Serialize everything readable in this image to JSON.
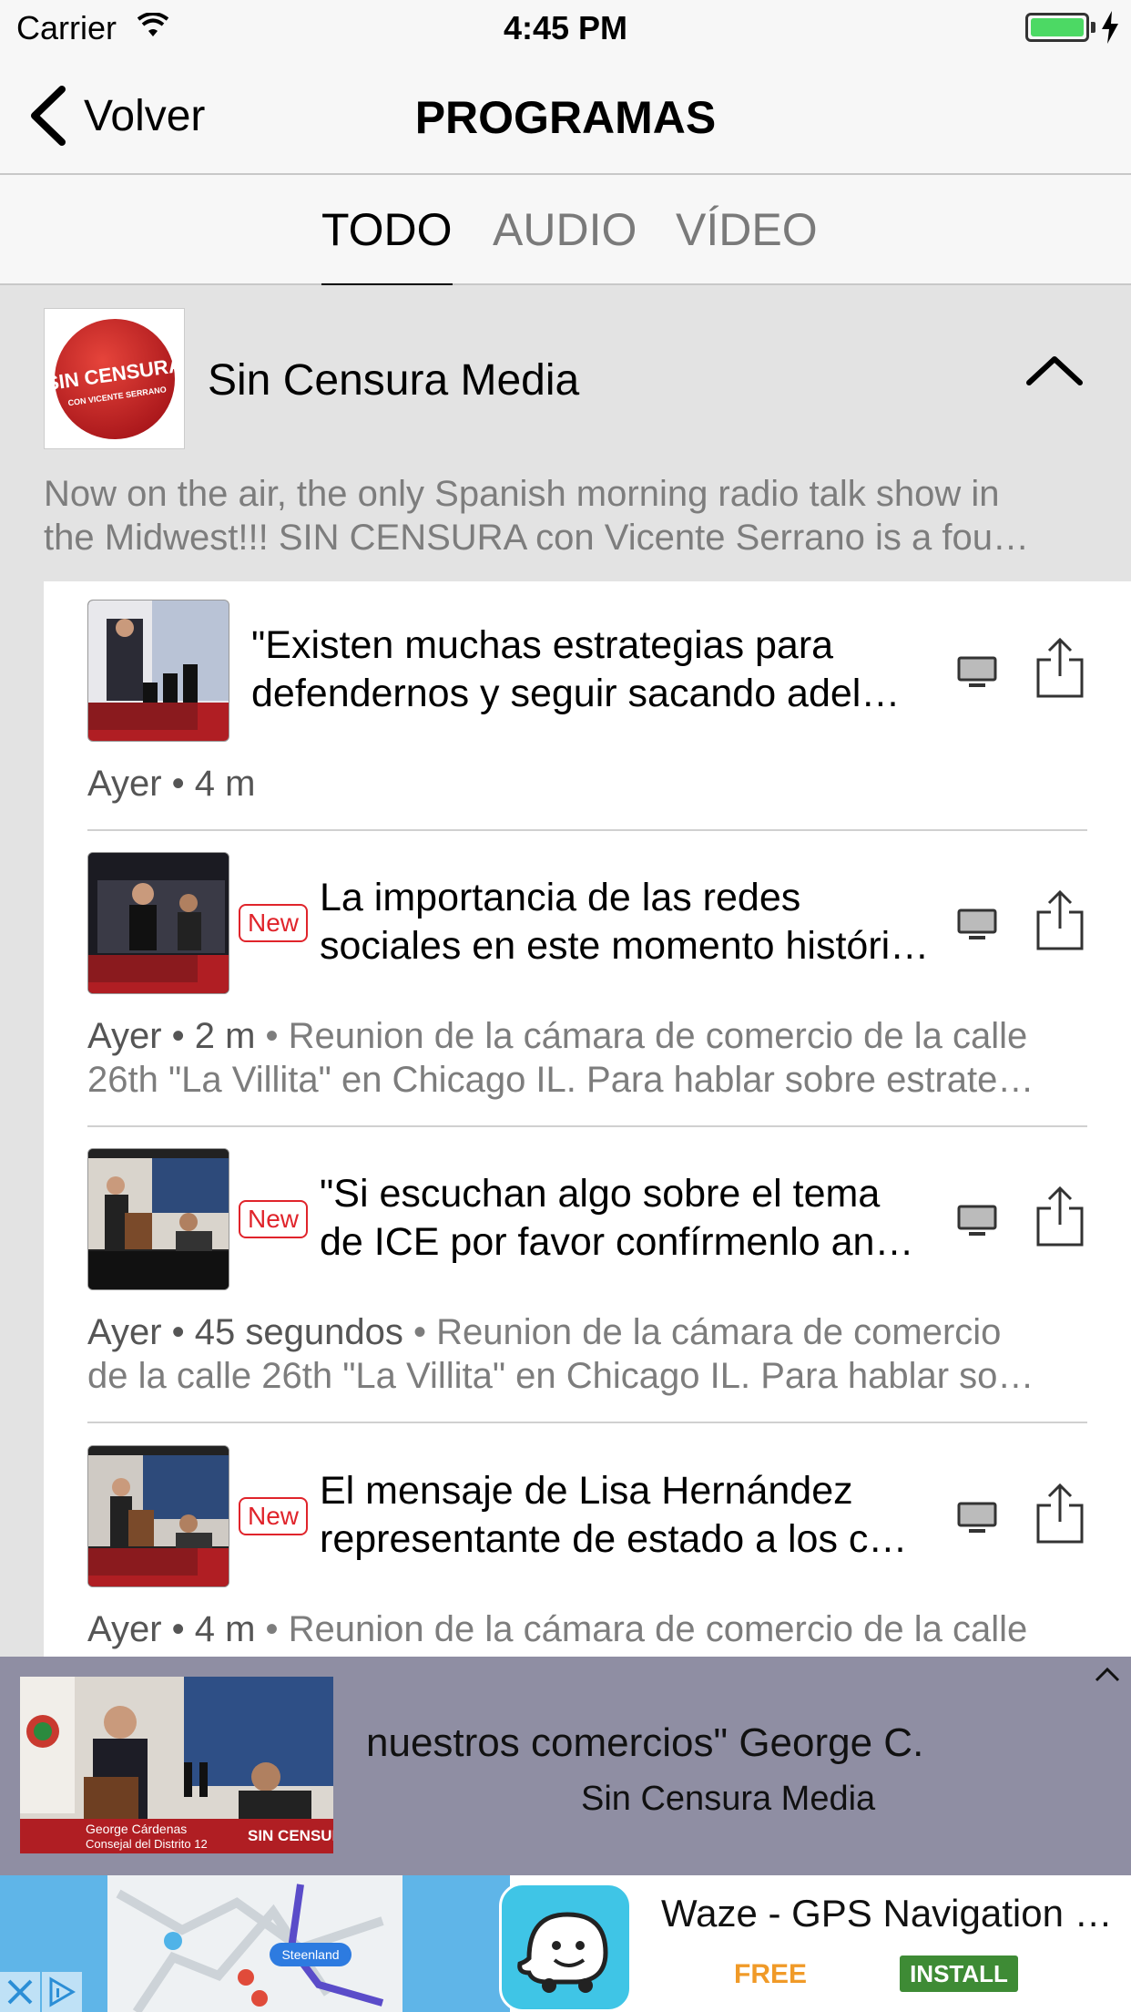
{
  "status_bar": {
    "carrier": "Carrier",
    "time": "4:45 PM"
  },
  "nav": {
    "back_label": "Volver",
    "title": "PROGRAMAS"
  },
  "tabs": [
    {
      "label": "TODO",
      "active": true
    },
    {
      "label": "AUDIO",
      "active": false
    },
    {
      "label": "VÍDEO",
      "active": false
    }
  ],
  "show": {
    "name": "Sin Censura Media",
    "logo_text_main": "SIN CENSURA",
    "logo_text_sub": "CON VICENTE SERRANO",
    "description_line1": "Now on the air, the only Spanish morning radio talk show in",
    "description_line2": "the Midwest!!! SIN CENSURA con Vicente Serrano is a fou…"
  },
  "episodes": [
    {
      "is_new": false,
      "title_line1": "\"Existen muchas estrategias para",
      "title_line2": "defendernos y seguir sacando adel…",
      "meta": "Ayer • 4 m",
      "description_line1": "",
      "description_line2": ""
    },
    {
      "is_new": true,
      "new_label": "New",
      "title_line1": "La importancia de las redes",
      "title_line2": "sociales en este momento históri…",
      "meta": "Ayer • 2 m",
      "description_line1": " • Reunion de la cámara de comercio de la calle",
      "description_line2": "26th \"La Villita\" en Chicago IL. Para hablar sobre estrate…"
    },
    {
      "is_new": true,
      "new_label": "New",
      "title_line1": "\"Si escuchan algo sobre el tema",
      "title_line2": "de ICE por favor confírmenlo an…",
      "meta": "Ayer • 45 segundos",
      "description_line1": " • Reunion de la cámara de comercio",
      "description_line2": "de la calle 26th \"La Villita\" en Chicago IL. Para hablar so…"
    },
    {
      "is_new": true,
      "new_label": "New",
      "title_line1": "El mensaje de Lisa Hernández",
      "title_line2": "representante de estado a los c…",
      "meta": "Ayer • 4 m",
      "description_line1": " • Reunion de la cámara de comercio de la calle",
      "description_line2": ""
    }
  ],
  "player": {
    "title": "nuestros comercios\" George C.",
    "show": "Sin Censura Media",
    "thumb_caption_name": "George Cárdenas",
    "thumb_caption_role": "Consejal del Distrito 12",
    "thumb_brand": "SIN CENSURA"
  },
  "ad": {
    "title": "Waze - GPS Navigation …",
    "price": "FREE",
    "install_label": "INSTALL",
    "map_label": "Steenland"
  },
  "colors": {
    "new_badge": "#e0242b",
    "install_button": "#3e8b35",
    "free_text": "#f09a28",
    "player_bg": "#8f8ea3",
    "battery": "#4cd964"
  }
}
